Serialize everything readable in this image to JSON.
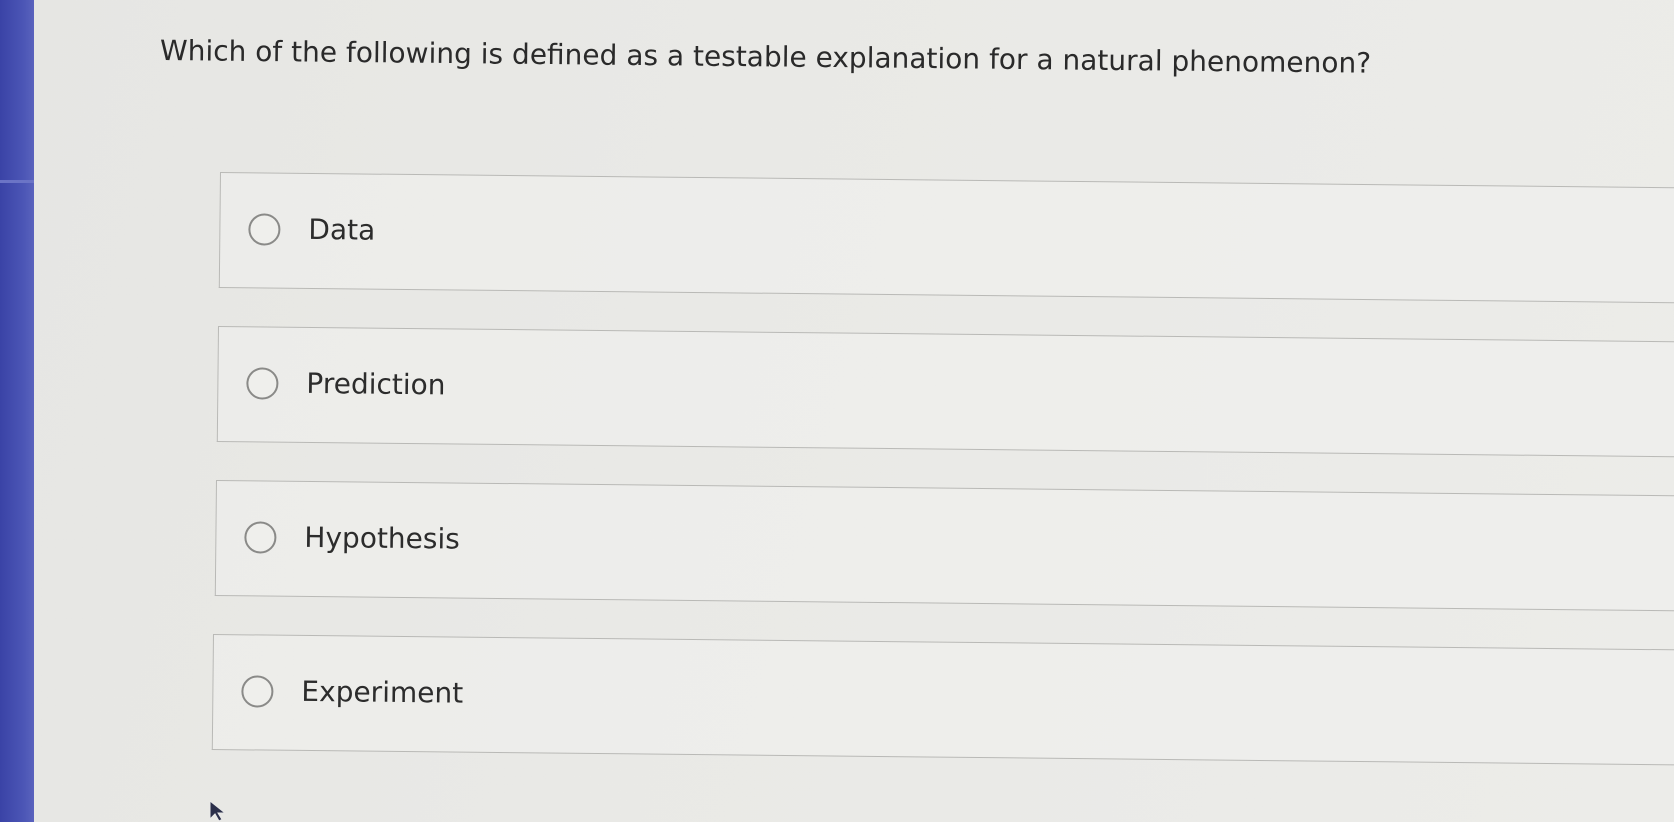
{
  "question": {
    "text": "Which of the following is defined as a testable explanation for a natural phenomenon?"
  },
  "options": [
    {
      "label": "Data",
      "selected": false
    },
    {
      "label": "Prediction",
      "selected": false
    },
    {
      "label": "Hypothesis",
      "selected": false
    },
    {
      "label": "Experiment",
      "selected": false
    }
  ],
  "colors": {
    "left_bar": "#4c56b6",
    "background": "#e9e9e6",
    "option_border": "#b9b9b6"
  },
  "icons": {
    "radio": "radio-circle-icon",
    "cursor": "mouse-pointer-icon"
  }
}
